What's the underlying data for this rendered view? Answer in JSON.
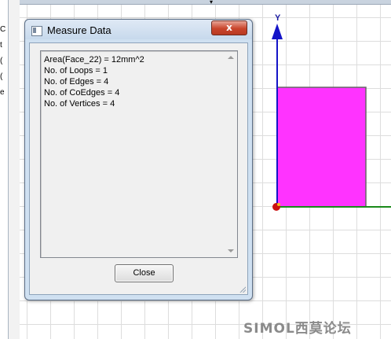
{
  "dialog": {
    "title": "Measure Data",
    "close_glyph": "x",
    "lines": [
      "Area(Face_22) = 12mm^2",
      "No. of Loops = 1",
      "No. of Edges = 4",
      "No. of CoEdges = 4",
      "No. of Vertices = 4"
    ],
    "close_button": "Close"
  },
  "viewport": {
    "y_axis_label": "Y",
    "face_color": "#ff33ff",
    "y_axis_color": "#1414c8",
    "x_axis_color": "#1a8a1a",
    "origin_color": "#cc1111"
  },
  "left_strip_chars": [
    "C",
    "t",
    "(",
    "(",
    "e"
  ],
  "watermark": "SIMOL西莫论坛"
}
